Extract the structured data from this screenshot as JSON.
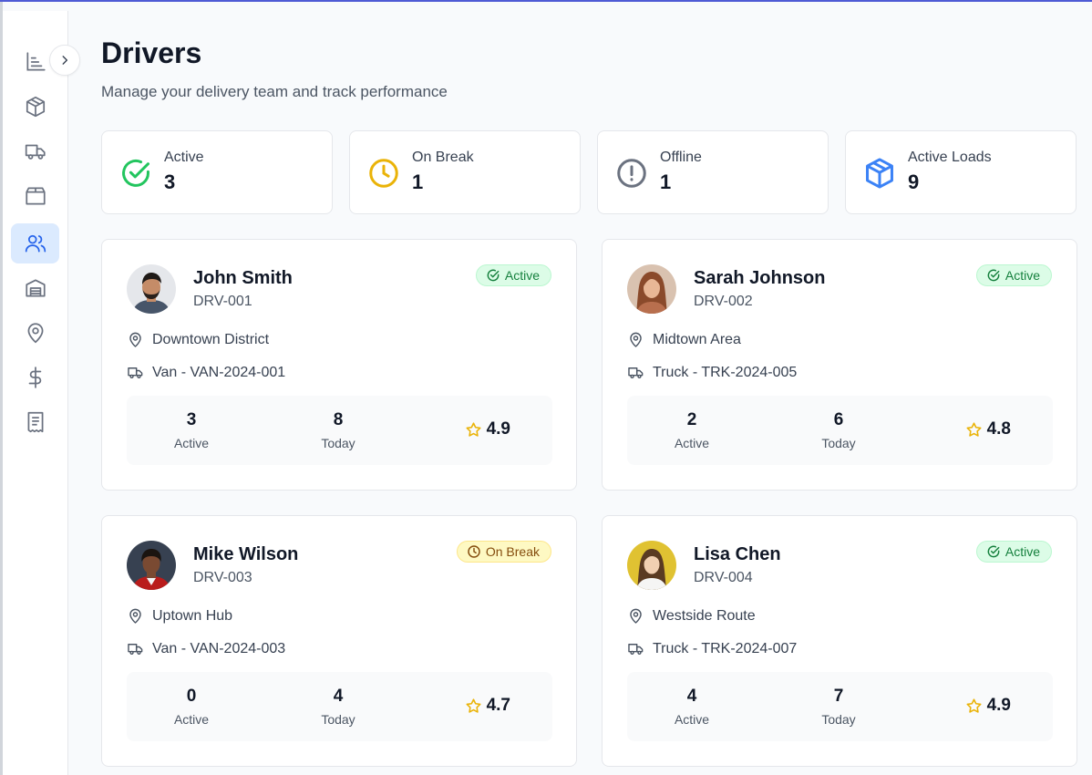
{
  "page": {
    "title": "Drivers",
    "subtitle": "Manage your delivery team and track performance"
  },
  "sidebar": {
    "items": [
      {
        "icon": "chart-icon"
      },
      {
        "icon": "package-icon"
      },
      {
        "icon": "truck-icon"
      },
      {
        "icon": "archive-box-icon"
      },
      {
        "icon": "users-icon",
        "active": true
      },
      {
        "icon": "warehouse-icon"
      },
      {
        "icon": "map-pin-icon"
      },
      {
        "icon": "dollar-icon"
      },
      {
        "icon": "receipt-icon"
      }
    ]
  },
  "stats": [
    {
      "label": "Active",
      "value": "3",
      "icon": "check-circle-icon",
      "color": "#22c55e"
    },
    {
      "label": "On Break",
      "value": "1",
      "icon": "clock-icon",
      "color": "#eab308"
    },
    {
      "label": "Offline",
      "value": "1",
      "icon": "alert-circle-icon",
      "color": "#6b7280"
    },
    {
      "label": "Active Loads",
      "value": "9",
      "icon": "package-icon",
      "color": "#3b82f6"
    }
  ],
  "drivers": [
    {
      "name": "John Smith",
      "id": "DRV-001",
      "status": "Active",
      "location": "Downtown District",
      "vehicle": "Van - VAN-2024-001",
      "active_count": "3",
      "active_label": "Active",
      "today_count": "8",
      "today_label": "Today",
      "rating": "4.9"
    },
    {
      "name": "Sarah Johnson",
      "id": "DRV-002",
      "status": "Active",
      "location": "Midtown Area",
      "vehicle": "Truck - TRK-2024-005",
      "active_count": "2",
      "active_label": "Active",
      "today_count": "6",
      "today_label": "Today",
      "rating": "4.8"
    },
    {
      "name": "Mike Wilson",
      "id": "DRV-003",
      "status": "On Break",
      "location": "Uptown Hub",
      "vehicle": "Van - VAN-2024-003",
      "active_count": "0",
      "active_label": "Active",
      "today_count": "4",
      "today_label": "Today",
      "rating": "4.7"
    },
    {
      "name": "Lisa Chen",
      "id": "DRV-004",
      "status": "Active",
      "location": "Westside Route",
      "vehicle": "Truck - TRK-2024-007",
      "active_count": "4",
      "active_label": "Active",
      "today_count": "7",
      "today_label": "Today",
      "rating": "4.9"
    }
  ],
  "colors": {
    "accent": "#2563eb",
    "active": "#15803d",
    "on_break": "#854d0e",
    "star": "#eab308"
  }
}
